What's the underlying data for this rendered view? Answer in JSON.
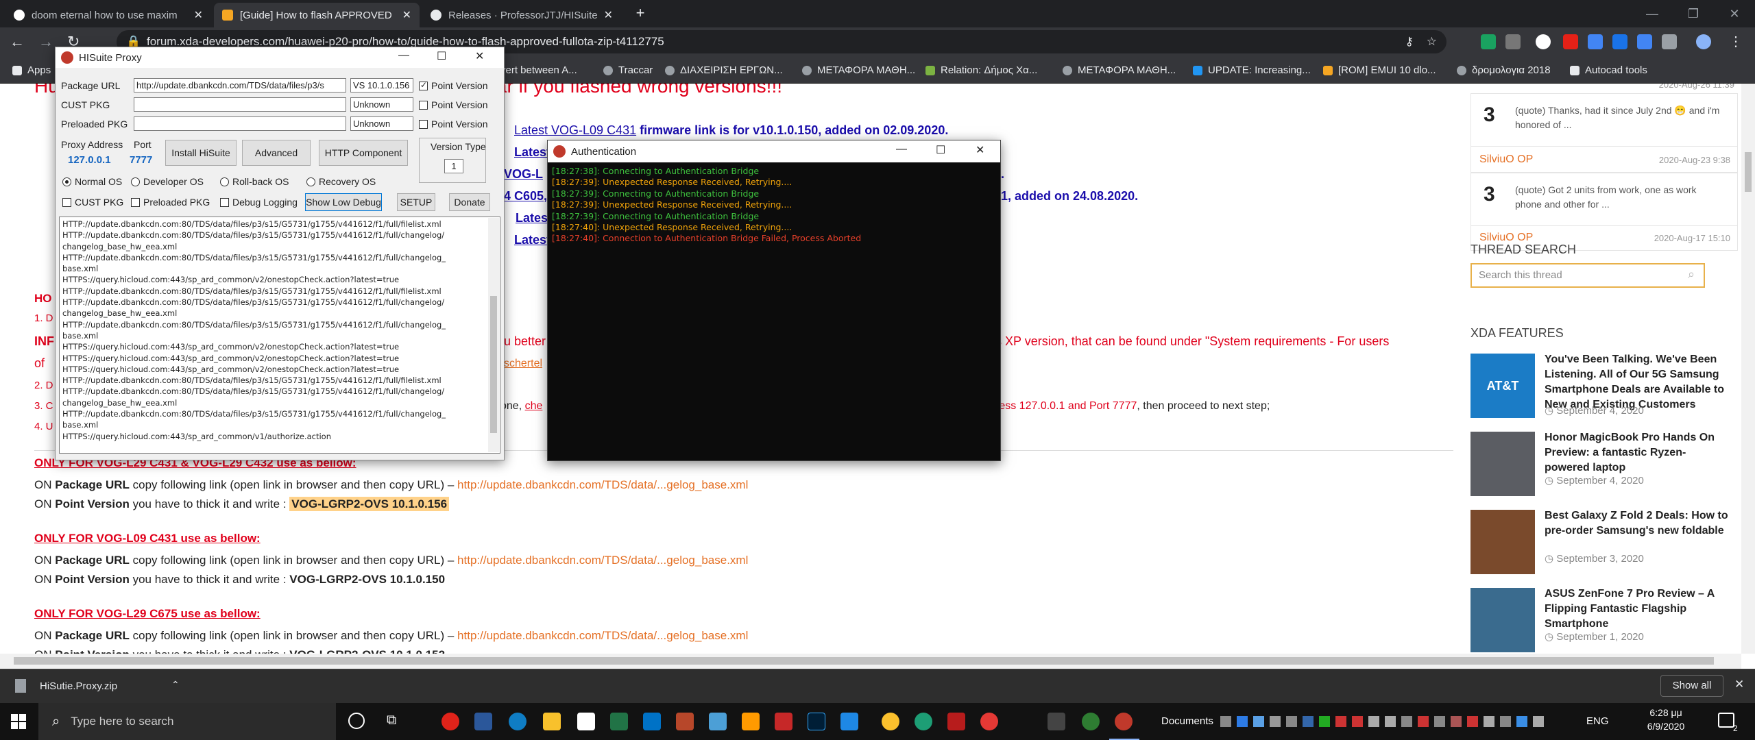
{
  "browser": {
    "tabs": [
      {
        "label": "doom eternal how to use maxim"
      },
      {
        "label": "[Guide] How to flash APPROVED"
      },
      {
        "label": "Releases · ProfessorJTJ/HISuite-P"
      }
    ],
    "url": "forum.xda-developers.com/huawei-p20-pro/how-to/guide-how-to-flash-approved-fullota-zip-t4112775",
    "bookmarks": [
      "Apps",
      "vert between A...",
      "Traccar",
      "ΔΙΑΧΕΙΡΙΣΗ ΕΡΓΩΝ...",
      "ΜΕΤΑΦΟΡΑ ΜΑΘΗ...",
      "Relation: Δήμος Χα...",
      "ΜΕΤΑΦΟΡΑ ΜΑΘΗ...",
      "UPDATE: Increasing...",
      "[ROM] EMUI 10 dlo...",
      "δρομολογια 2018",
      "Autocad tools"
    ],
    "icons": {
      "back": "back-arrow-icon",
      "forward": "forward-arrow-icon",
      "reload": "reload-icon",
      "star": "star-icon",
      "key": "key-icon"
    }
  },
  "article": {
    "header_text": "Huawei NV cards or any other problems that can appear if you flashed wrong versions!!!",
    "latest_links": [
      {
        "link": "Latest VOG-L09 C431",
        "rest": " firmware link is for v10.1.0.150, added on 02.09.2020."
      },
      {
        "link": "Latest",
        "rest": ""
      },
      {
        "link": "VOG-L",
        "rest": ""
      },
      {
        "link": "4 C605,",
        "rest": ""
      },
      {
        "link": "Latest",
        "rest": ""
      },
      {
        "link": "Latest",
        "rest": ""
      }
    ],
    "partial_right_1": "0.",
    "partial_right_2": "61, added on 24.08.2020.",
    "ho_prefix": "HO",
    "line1": "1. D",
    "inf_prefix": "INF",
    "info_mid": "u better",
    "info_right": "s XP version, that can be found under \"System requirements - For users",
    "of_prefix": "of",
    "of_link": "schertel",
    "step2": "2. D",
    "step3": "3. C",
    "step3_text": "one,",
    "step3_link": "che",
    "step3_right": "ress 127.0.0.1 and Port 7777",
    "step3_end": ", then proceed to next step;",
    "step4": "4. U",
    "sections": [
      {
        "title": "ONLY FOR VOG-L29 C431 & VOG-L29 C432 use as bellow:",
        "on1": "ON ",
        "pkg": "Package URL",
        "copy": " copy following link (open link in browser and then copy URL) – ",
        "url": "http://update.dbankcdn.com/TDS/data/...gelog_base.xml",
        "on2": "ON ",
        "pv": "Point Version",
        "thick": " you have to thick it and write : ",
        "ver": "VOG-LGRP2-OVS 10.1.0.156"
      },
      {
        "title": "ONLY FOR VOG-L09 C431 use as bellow:",
        "on1": "ON ",
        "pkg": "Package URL",
        "copy": " copy following link (open link in browser and then copy URL) – ",
        "url": "http://update.dbankcdn.com/TDS/data/...gelog_base.xml",
        "on2": "ON ",
        "pv": "Point Version",
        "thick": " you have to thick it and write : ",
        "ver": "VOG-LGRP2-OVS 10.1.0.150"
      },
      {
        "title": "ONLY FOR VOG-L29 C675 use as bellow:",
        "on1": "ON ",
        "pkg": "Package URL",
        "copy": " copy following link (open link in browser and then copy URL) – ",
        "url": "http://update.dbankcdn.com/TDS/data/...gelog_base.xml",
        "on2": "ON ",
        "pv": "Point Version",
        "thick": " you have to thick it and write : ",
        "ver": "VOG-LGRP2-OVS 10.1.0.152"
      }
    ]
  },
  "sidebar": {
    "top_meta": "2020-Aug-26 11:39",
    "posts": [
      {
        "count": "3",
        "text": "(quote) Thanks, had it since July 2nd 😁 and i'm honored of ...",
        "user": "SilviuO",
        "op": "OP",
        "date": "2020-Aug-23 9:38"
      },
      {
        "count": "3",
        "text": "(quote) Got 2 units from work, one as work phone and other for ...",
        "user": "SilviuO",
        "op": "OP",
        "date": "2020-Aug-17 15:10"
      }
    ],
    "top_user": "SilviuO OP",
    "search_heading": "THREAD SEARCH",
    "search_placeholder": "Search this thread",
    "features_heading": "XDA FEATURES",
    "features": [
      {
        "title": "You've Been Talking. We've Been Listening. All of Our 5G Samsung Smartphone Deals are Available to New and Existing Customers",
        "date": "September 4, 2020",
        "thumb": "AT&T",
        "color": "#1b7cc6"
      },
      {
        "title": "Honor MagicBook Pro Hands On Preview: a fantastic Ryzen-powered laptop",
        "date": "September 4, 2020",
        "thumb": "",
        "color": "#5b5d63"
      },
      {
        "title": "Best Galaxy Z Fold 2 Deals: How to pre-order Samsung's new foldable",
        "date": "September 3, 2020",
        "thumb": "",
        "color": "#7a4a2c"
      },
      {
        "title": "ASUS ZenFone 7 Pro Review – A Flipping Fantastic Flagship Smartphone",
        "date": "September 1, 2020",
        "thumb": "",
        "color": "#3a6b8e"
      }
    ]
  },
  "hisuite": {
    "title": "HISuite Proxy",
    "package_url_label": "Package URL",
    "package_url": "http://update.dbankcdn.com/TDS/data/files/p3/s",
    "package_ver": "VS 10.1.0.156",
    "cust_label": "CUST PKG",
    "cust_ver": "Unknown",
    "preloaded_label": "Preloaded PKG",
    "preloaded_ver": "Unknown",
    "point_version": "Point Version",
    "proxy_address_label": "Proxy Address",
    "port_label": "Port",
    "proxy_address": "127.0.0.1",
    "port": "7777",
    "install_btn": "Install HiSuite",
    "advanced_btn": "Advanced",
    "http_btn": "HTTP Component",
    "version_type_label": "Version Type",
    "version_type": "1",
    "radios": [
      "Normal OS",
      "Developer OS",
      "Roll-back OS",
      "Recovery OS"
    ],
    "checks": [
      "CUST PKG",
      "Preloaded PKG",
      "Debug Logging"
    ],
    "show_low_debug": "Show Low Debug",
    "setup": "SETUP",
    "donate": "Donate",
    "log": [
      "HTTP://update.dbankcdn.com:80/TDS/data/files/p3/s15/G5731/g1755/v441612/f1/full/filelist.xml",
      "HTTP://update.dbankcdn.com:80/TDS/data/files/p3/s15/G5731/g1755/v441612/f1/full/changelog/",
      "changelog_base_hw_eea.xml",
      "HTTP://update.dbankcdn.com:80/TDS/data/files/p3/s15/G5731/g1755/v441612/f1/full/changelog_",
      "base.xml",
      "HTTPS://query.hicloud.com:443/sp_ard_common/v2/onestopCheck.action?latest=true",
      "HTTP://update.dbankcdn.com:80/TDS/data/files/p3/s15/G5731/g1755/v441612/f1/full/filelist.xml",
      "HTTP://update.dbankcdn.com:80/TDS/data/files/p3/s15/G5731/g1755/v441612/f1/full/changelog/",
      "changelog_base_hw_eea.xml",
      "HTTP://update.dbankcdn.com:80/TDS/data/files/p3/s15/G5731/g1755/v441612/f1/full/changelog_",
      "base.xml",
      "HTTPS://query.hicloud.com:443/sp_ard_common/v2/onestopCheck.action?latest=true",
      "HTTPS://query.hicloud.com:443/sp_ard_common/v2/onestopCheck.action?latest=true",
      "HTTPS://query.hicloud.com:443/sp_ard_common/v2/onestopCheck.action?latest=true",
      "HTTP://update.dbankcdn.com:80/TDS/data/files/p3/s15/G5731/g1755/v441612/f1/full/filelist.xml",
      "HTTP://update.dbankcdn.com:80/TDS/data/files/p3/s15/G5731/g1755/v441612/f1/full/changelog/",
      "changelog_base_hw_eea.xml",
      "HTTP://update.dbankcdn.com:80/TDS/data/files/p3/s15/G5731/g1755/v441612/f1/full/changelog_",
      "base.xml",
      "HTTPS://query.hicloud.com:443/sp_ard_common/v1/authorize.action"
    ]
  },
  "auth": {
    "title": "Authentication",
    "lines": [
      {
        "t": "[18:27:38]: Connecting to Authentication Bridge",
        "c": "#3ec13e"
      },
      {
        "t": "[18:27:39]: Unexpected Response Received, Retrying....",
        "c": "#f0a30a"
      },
      {
        "t": "[18:27:39]: Connecting to Authentication Bridge",
        "c": "#3ec13e"
      },
      {
        "t": "[18:27:39]: Unexpected Response Received, Retrying....",
        "c": "#f0a30a"
      },
      {
        "t": "[18:27:39]: Connecting to Authentication Bridge",
        "c": "#3ec13e"
      },
      {
        "t": "[18:27:40]: Unexpected Response Received, Retrying....",
        "c": "#f0a30a"
      },
      {
        "t": "[18:27:40]: Connection to Authentication Bridge Failed, Process Aborted",
        "c": "#e8402a"
      }
    ]
  },
  "download_bar": {
    "file": "HiSutie.Proxy.zip",
    "show_all": "Show all"
  },
  "taskbar": {
    "search_placeholder": "Type here to search",
    "documents": "Documents",
    "lang": "ENG",
    "time": "6:28 μμ",
    "date": "6/9/2020",
    "notif_count": "2"
  }
}
